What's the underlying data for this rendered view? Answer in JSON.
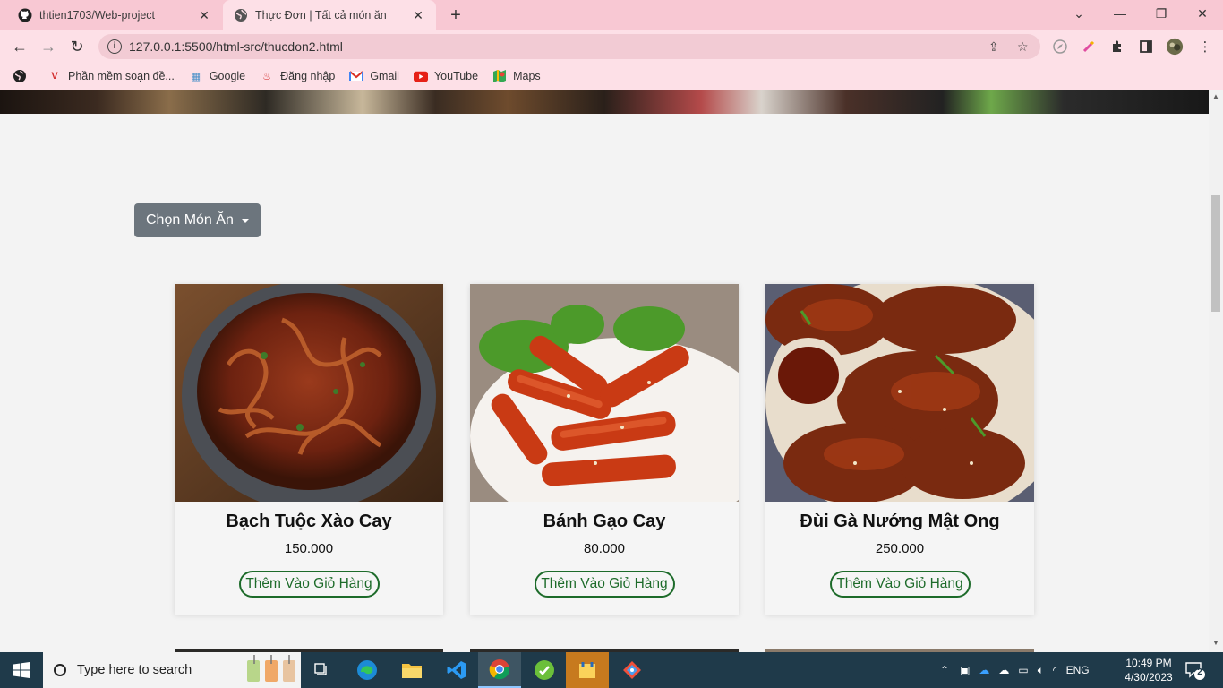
{
  "browser": {
    "tabs": [
      {
        "title": "thtien1703/Web-project",
        "icon": "github-icon"
      },
      {
        "title": "Thực Đơn | Tất cả món ăn",
        "icon": "globe-icon"
      }
    ],
    "url": "127.0.0.1:5500/html-src/thucdon2.html",
    "bookmarks": [
      {
        "label": "Phần mềm soạn đề...",
        "icon": "v-logo-icon"
      },
      {
        "label": "Google",
        "icon": "google-icon"
      },
      {
        "label": "Đăng nhập",
        "icon": "login-icon"
      },
      {
        "label": "Gmail",
        "icon": "gmail-icon"
      },
      {
        "label": "YouTube",
        "icon": "youtube-icon"
      },
      {
        "label": "Maps",
        "icon": "maps-icon"
      }
    ]
  },
  "page": {
    "dropdown_label": "Chọn Món Ăn",
    "products": [
      {
        "name": "Bạch Tuộc Xào Cay",
        "price": "150.000",
        "button": "Thêm Vào Giỏ Hàng",
        "image": "spicy-octopus-photo"
      },
      {
        "name": "Bánh Gạo Cay",
        "price": "80.000",
        "button": "Thêm Vào Giỏ Hàng",
        "image": "tteokbokki-photo"
      },
      {
        "name": "Đùi Gà Nướng Mật Ong",
        "price": "250.000",
        "button": "Thêm Vào Giỏ Hàng",
        "image": "honey-chicken-photo"
      }
    ]
  },
  "taskbar": {
    "search_placeholder": "Type here to search",
    "language": "ENG",
    "time": "10:49 PM",
    "date": "4/30/2023",
    "notification_count": "2"
  },
  "colors": {
    "tab_strip": "#f8c8d3",
    "toolbar": "#fde0e7",
    "dropdown": "#6c757d",
    "add_button": "#1d6b2a",
    "taskbar": "#1f3a4a"
  }
}
